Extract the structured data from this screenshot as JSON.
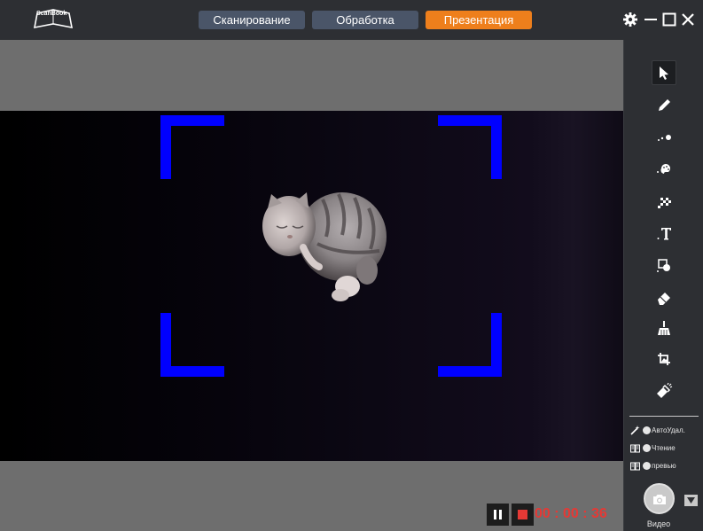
{
  "app": {
    "logo_text": "ScanBook"
  },
  "tabs": {
    "scan": "Сканирование",
    "process": "Обработка",
    "present": "Презентация"
  },
  "colors": {
    "tab_inactive": "#4a5568",
    "tab_active": "#ee7f1c",
    "bracket": "#0000ff",
    "timer": "#e53935"
  },
  "recording": {
    "timer": "00 : 00 : 36"
  },
  "sidebar": {
    "tools": [
      {
        "name": "select-cursor-icon"
      },
      {
        "name": "pen-icon"
      },
      {
        "name": "laser-pointer-icon"
      },
      {
        "name": "color-palette-icon"
      },
      {
        "name": "mosaic-icon"
      },
      {
        "name": "text-icon"
      },
      {
        "name": "shapes-icon"
      },
      {
        "name": "eraser-icon"
      },
      {
        "name": "clear-broom-icon"
      },
      {
        "name": "image-insert-icon"
      },
      {
        "name": "spotlight-icon"
      }
    ],
    "options": {
      "auto_delete": "АвтоУдал.",
      "reading": "Чтение",
      "preview": "превью"
    },
    "capture_mode": "Видео"
  }
}
